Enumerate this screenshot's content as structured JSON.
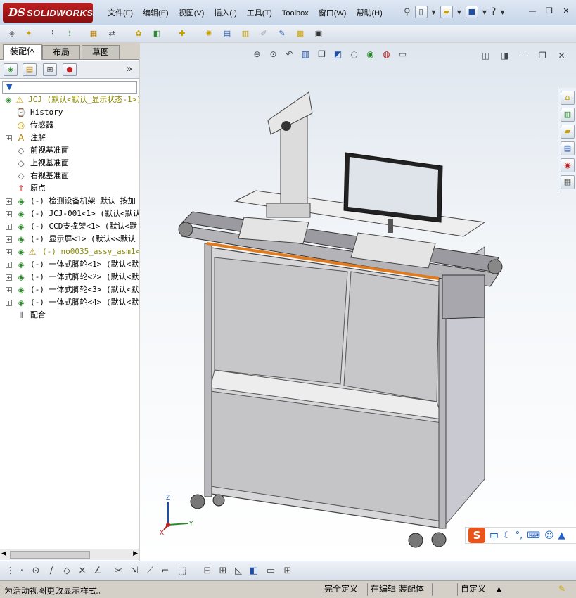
{
  "app": {
    "logo_ds": "DS",
    "logo_text": "SOLIDWORKS"
  },
  "menu": [
    {
      "label": "文件(F)"
    },
    {
      "label": "编辑(E)"
    },
    {
      "label": "视图(V)"
    },
    {
      "label": "插入(I)"
    },
    {
      "label": "工具(T)"
    },
    {
      "label": "Toolbox"
    },
    {
      "label": "窗口(W)"
    },
    {
      "label": "帮助(H)"
    }
  ],
  "tabs": [
    {
      "label": "装配体",
      "active": true
    },
    {
      "label": "布局",
      "active": false
    },
    {
      "label": "草图",
      "active": false
    }
  ],
  "panel": {
    "expand_glyph": "»"
  },
  "tree": {
    "root": "JCJ  (默认<默认_显示状态-1>)",
    "items": [
      {
        "label": "History",
        "icon": "history-icon",
        "expandable": false
      },
      {
        "label": "传感器",
        "icon": "sensor-icon",
        "expandable": false
      },
      {
        "label": "注解",
        "icon": "annotation-icon",
        "expandable": true
      },
      {
        "label": "前视基准面",
        "icon": "plane-icon",
        "expandable": false
      },
      {
        "label": "上视基准面",
        "icon": "plane-icon",
        "expandable": false
      },
      {
        "label": "右视基准面",
        "icon": "plane-icon",
        "expandable": false
      },
      {
        "label": "原点",
        "icon": "origin-icon",
        "expandable": false
      },
      {
        "label": "(-) 检测设备机架_默认_按加",
        "icon": "part-icon",
        "expandable": true
      },
      {
        "label": "(-) JCJ-001<1> (默认<默认",
        "icon": "part-icon",
        "expandable": true
      },
      {
        "label": "(-) CCD支撑架<1> (默认<默",
        "icon": "part-icon",
        "expandable": true
      },
      {
        "label": "(-) 显示屏<1> (默认<<默认_",
        "icon": "part-icon",
        "expandable": true
      },
      {
        "label": "(-) no0035_assy_asm1<1>",
        "icon": "part-icon",
        "expandable": true,
        "warning": true
      },
      {
        "label": "(-) 一体式脚轮<1> (默认<默",
        "icon": "part-icon",
        "expandable": true
      },
      {
        "label": "(-) 一体式脚轮<2> (默认<默",
        "icon": "part-icon",
        "expandable": true
      },
      {
        "label": "(-) 一体式脚轮<3> (默认<默",
        "icon": "part-icon",
        "expandable": true
      },
      {
        "label": "(-) 一体式脚轮<4> (默认<默",
        "icon": "part-icon",
        "expandable": true
      },
      {
        "label": "配合",
        "icon": "mates-icon",
        "expandable": false
      }
    ]
  },
  "ime": {
    "logo": "S",
    "mode": "中"
  },
  "triad": {
    "x": "X",
    "y": "Y",
    "z": "Z"
  },
  "status": {
    "message": "为活动视图更改显示样式。",
    "definition": "完全定义",
    "editing": "在编辑 装配体",
    "units": "自定义",
    "caret": "▲"
  },
  "colors": {
    "accent": "#c02020",
    "panel_bg": "#ffffff",
    "chrome": "#d4d0c8"
  }
}
